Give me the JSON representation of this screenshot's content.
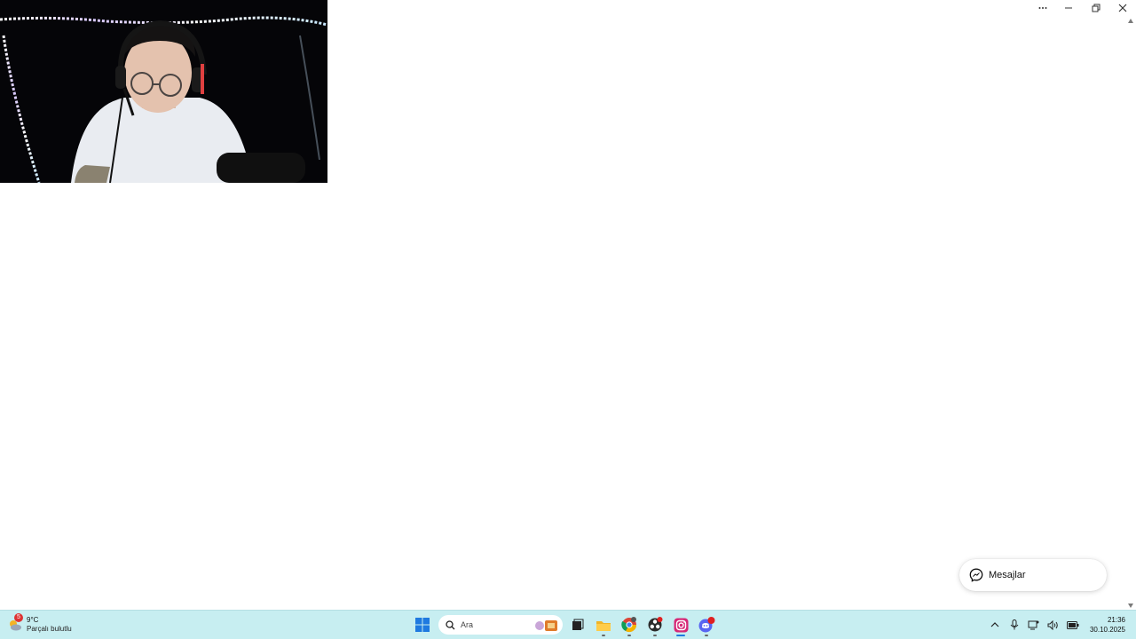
{
  "window": {
    "controls": [
      {
        "name": "more-options",
        "icon": "ellipsis-icon"
      },
      {
        "name": "minimize",
        "icon": "minimize-icon"
      },
      {
        "name": "restore",
        "icon": "restore-icon"
      },
      {
        "name": "close",
        "icon": "close-icon"
      }
    ]
  },
  "messages_widget": {
    "label": "Mesajlar",
    "icon": "messenger-icon"
  },
  "taskbar": {
    "weather": {
      "badge": "5",
      "temperature": "9°C",
      "condition": "Parçalı bulutlu",
      "icon": "weather-icon"
    },
    "search": {
      "label": "Ara",
      "icon": "search-icon"
    },
    "apps": [
      {
        "name": "start",
        "icon": "windows-start-icon"
      },
      {
        "name": "task-view",
        "icon": "task-view-icon"
      },
      {
        "name": "file-explorer",
        "icon": "folder-icon"
      },
      {
        "name": "chrome",
        "icon": "chrome-icon"
      },
      {
        "name": "obs",
        "icon": "obs-icon"
      },
      {
        "name": "instagram",
        "icon": "instagram-icon"
      },
      {
        "name": "discord",
        "icon": "discord-icon",
        "badge": "9+"
      }
    ],
    "tray": {
      "icons": [
        "chevron-up-icon",
        "microphone-icon",
        "network-icon",
        "volume-icon",
        "battery-icon"
      ],
      "time": "21:36",
      "date": "30.10.2025"
    }
  },
  "colors": {
    "taskbar_bg": "#c7eef1",
    "page_bg": "#ffffff",
    "start_blue": "#1f7ae0",
    "instagram": "#d62976",
    "discord": "#5865f2"
  }
}
